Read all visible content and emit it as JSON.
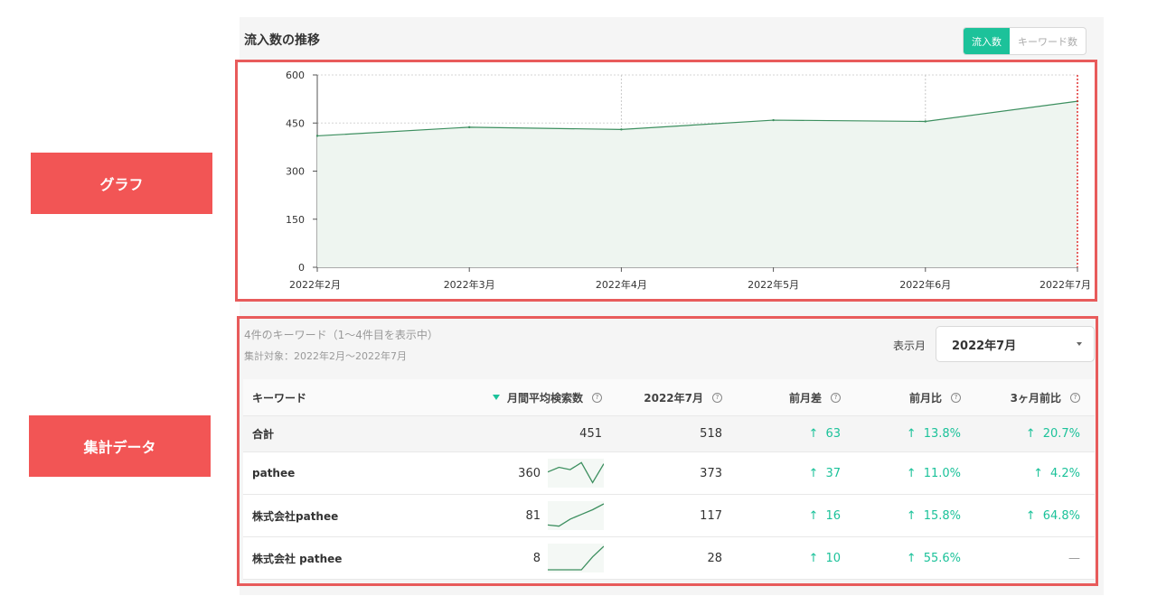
{
  "callouts": {
    "graph": "グラフ",
    "data": "集計データ"
  },
  "section": {
    "title": "流入数の推移"
  },
  "toggle": {
    "options": [
      "流入数",
      "キーワード数"
    ],
    "active": 0
  },
  "colors": {
    "accent": "#1cc29a",
    "callout": "#f25555",
    "line": "#3c8f5f",
    "marker": "#e03030"
  },
  "chart_data": {
    "type": "area",
    "categories": [
      "2022年2月",
      "2022年3月",
      "2022年4月",
      "2022年5月",
      "2022年6月",
      "2022年7月"
    ],
    "series": [
      {
        "values": [
          410,
          437,
          430,
          459,
          455,
          518
        ]
      }
    ],
    "yticks": [
      "0",
      "150",
      "300",
      "450",
      "600"
    ],
    "ylim": [
      0,
      600
    ],
    "grid": true,
    "marker_at": "2022年7月"
  },
  "summary": {
    "line1": "4件のキーワード（1〜4件目を表示中）",
    "line2": "集計対象：2022年2月〜2022年7月"
  },
  "month": {
    "label": "表示月",
    "value": "2022年7月"
  },
  "table": {
    "headers": {
      "keyword": "キーワード",
      "avg": "月間平均検索数",
      "month": "2022年7月",
      "diff": "前月差",
      "ratio": "前月比",
      "ratio3": "3ヶ月前比"
    },
    "total": {
      "label": "合計",
      "avg": "451",
      "month": "518",
      "diff": "63",
      "ratio": "13.8%",
      "ratio3": "20.7%"
    },
    "rows": [
      {
        "keyword": "pathee",
        "avg": "360",
        "month": "373",
        "diff": "37",
        "ratio": "11.0%",
        "ratio3": "4.2%",
        "spark": [
          0.55,
          0.75,
          0.65,
          0.95,
          0.1,
          0.9
        ]
      },
      {
        "keyword": "株式会社pathee",
        "avg": "81",
        "month": "117",
        "diff": "16",
        "ratio": "15.8%",
        "ratio3": "64.8%",
        "spark": [
          0.1,
          0.05,
          0.35,
          0.55,
          0.75,
          1.0
        ]
      },
      {
        "keyword": "株式会社 pathee",
        "avg": "8",
        "month": "28",
        "diff": "10",
        "ratio": "55.6%",
        "ratio3": "—",
        "spark": [
          0.0,
          0.0,
          0.0,
          0.0,
          0.55,
          1.0
        ]
      }
    ],
    "up_arrow": "↑"
  }
}
